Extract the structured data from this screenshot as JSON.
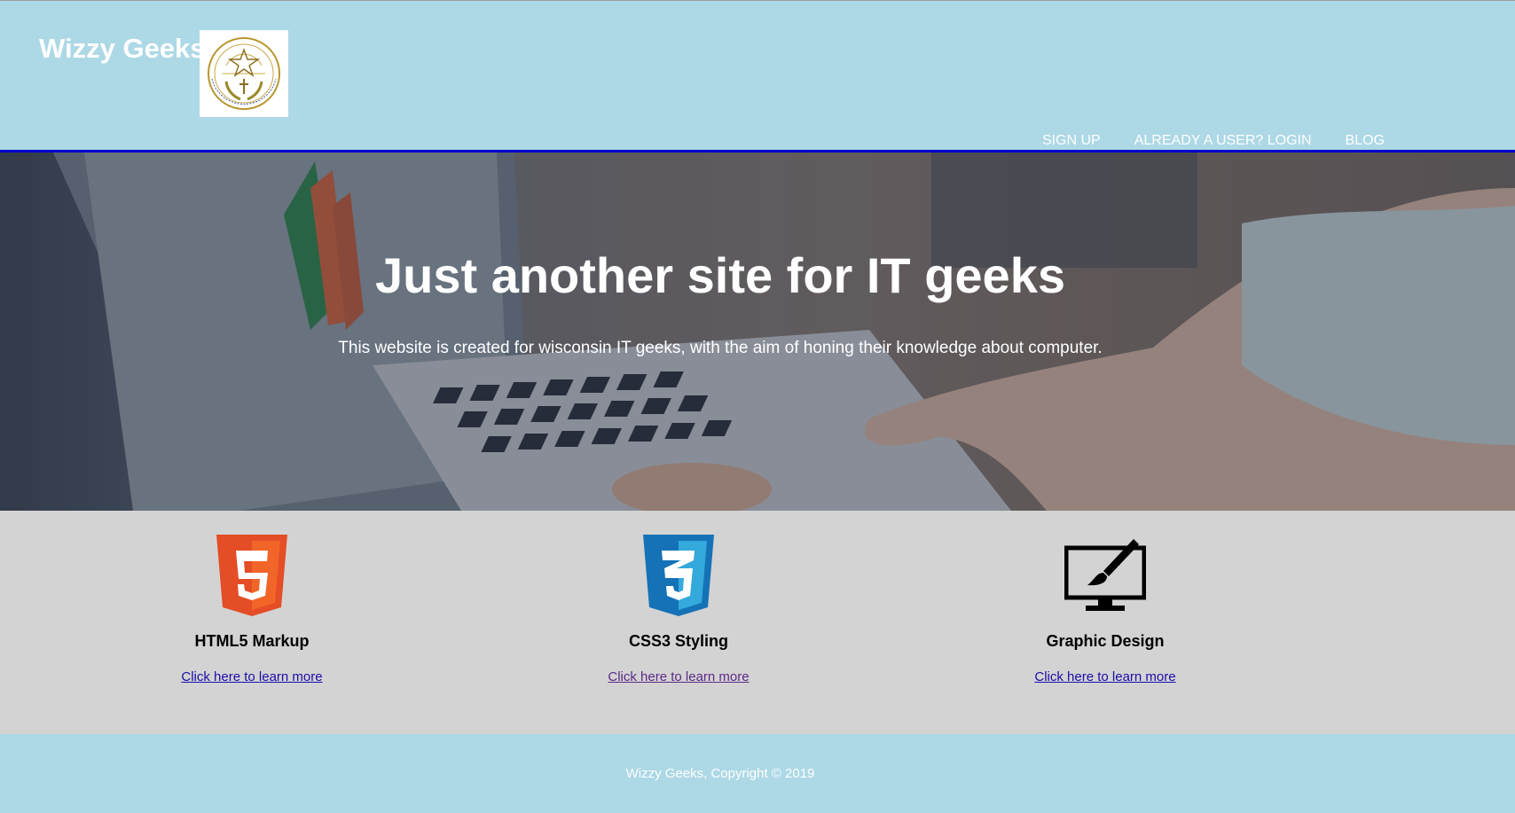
{
  "header": {
    "brand": "Wizzy Geeks",
    "nav": [
      {
        "label": "SIGN UP"
      },
      {
        "label": "ALREADY A USER? LOGIN"
      },
      {
        "label": "BLOG"
      }
    ]
  },
  "hero": {
    "title": "Just another site for IT geeks",
    "subtitle": "This website is created for wisconsin IT geeks, with the aim of honing their knowledge about computer."
  },
  "features": [
    {
      "icon": "html5-icon",
      "title": "HTML5 Markup",
      "link": "Click here to learn more"
    },
    {
      "icon": "css3-icon",
      "title": "CSS3 Styling",
      "link": "Click here to learn more"
    },
    {
      "icon": "monitor-brush-icon",
      "title": "Graphic Design",
      "link": "Click here to learn more"
    }
  ],
  "footer": {
    "copyright": "Wizzy Geeks, Copyright © 2019"
  },
  "colors": {
    "header_bg": "#add8e6",
    "header_border": "#0000cc",
    "features_bg": "#d3d3d3",
    "link": "#1a0dab",
    "link_visited": "#5b2a86",
    "html5_orange": "#e44d26",
    "css3_blue": "#1572b6"
  }
}
